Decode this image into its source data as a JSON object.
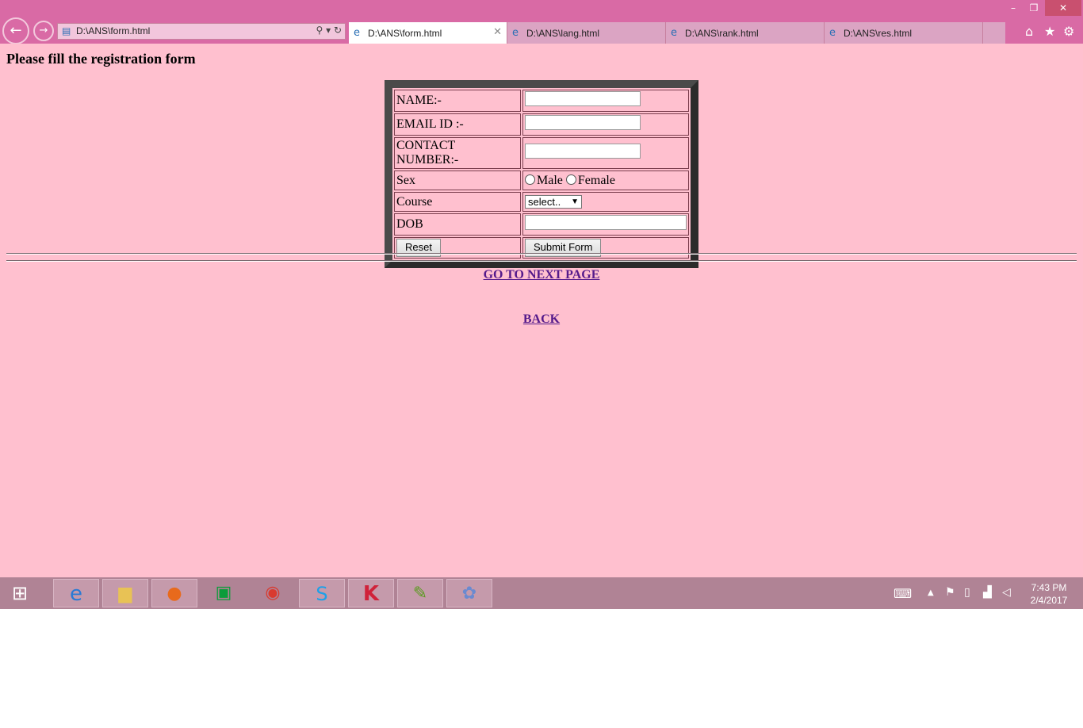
{
  "window": {
    "minimize": "–",
    "restore": "❐",
    "close": "✕"
  },
  "nav": {
    "back_icon": "←",
    "forward_icon": "→"
  },
  "address_bar": {
    "url": "D:\\ANS\\form.html",
    "tools": "⚲ ▾ ↻"
  },
  "tabs": [
    {
      "label": "D:\\ANS\\form.html",
      "active": true
    },
    {
      "label": "D:\\ANS\\lang.html",
      "active": false
    },
    {
      "label": "D:\\ANS\\rank.html",
      "active": false
    },
    {
      "label": "D:\\ANS\\res.html",
      "active": false
    }
  ],
  "toolbar_icons": {
    "home": "⌂",
    "star": "★",
    "gear": "⚙"
  },
  "page": {
    "title": "Please fill the registration form",
    "form": {
      "name_label": "NAME:-",
      "email_label": "EMAIL ID :-",
      "contact_label": "CONTACT NUMBER:-",
      "sex_label": "Sex",
      "male_label": "Male",
      "female_label": "Female",
      "course_label": "Course",
      "course_selected": "select..",
      "dob_label": "DOB",
      "reset_label": "Reset",
      "submit_label": "Submit Form"
    },
    "next_link": "GO TO NEXT PAGE",
    "back_link": "BACK"
  },
  "taskbar": {
    "items": [
      "internet-explorer",
      "file-explorer",
      "firefox",
      "store",
      "chrome",
      "skype",
      "kaspersky",
      "notepad",
      "paint"
    ],
    "time": "7:43 PM",
    "date": "2/4/2017"
  },
  "colors": {
    "page_bg": "#ffc0cf",
    "chrome_bg": "#d96aa5",
    "link": "#551a8b"
  }
}
